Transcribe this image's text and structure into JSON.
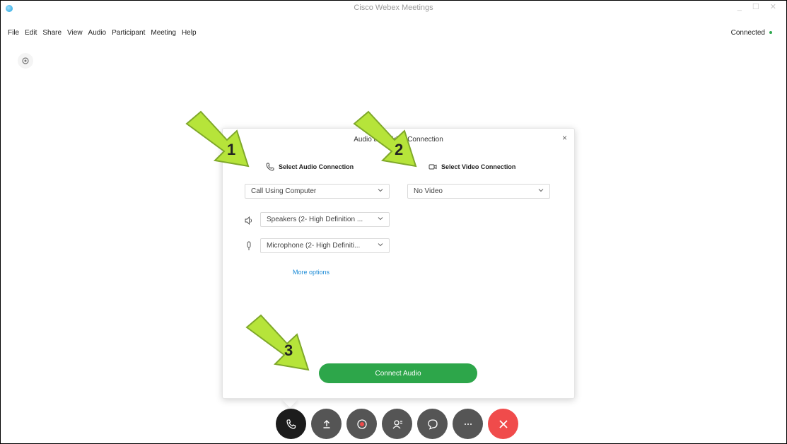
{
  "window": {
    "title": "Cisco Webex Meetings",
    "controls": "_ ☐ ✕"
  },
  "menu": {
    "items": [
      "File",
      "Edit",
      "Share",
      "View",
      "Audio",
      "Participant",
      "Meeting",
      "Help"
    ]
  },
  "status": {
    "text": "Connected"
  },
  "dialog": {
    "title": "Audio and Video Connection",
    "close": "×",
    "audio_section_label": "Select Audio Connection",
    "video_section_label": "Select Video Connection",
    "audio_select": "Call Using Computer",
    "video_select": "No Video",
    "speaker_select": "Speakers (2- High Definition ...",
    "microphone_select": "Microphone (2- High Definiti...",
    "more_options": "More options",
    "connect_button": "Connect Audio"
  },
  "annotations": {
    "arrow1": "1",
    "arrow2": "2",
    "arrow3": "3"
  },
  "toolbar": {
    "buttons": [
      "audio-connection",
      "share",
      "record",
      "participants",
      "chat",
      "more",
      "leave"
    ]
  },
  "colors": {
    "accent_green": "#2da64a",
    "link_blue": "#1c8bd6",
    "leave_red": "#f04b4b",
    "arrow_fill": "#b6e43a",
    "arrow_stroke": "#7fa82a"
  }
}
